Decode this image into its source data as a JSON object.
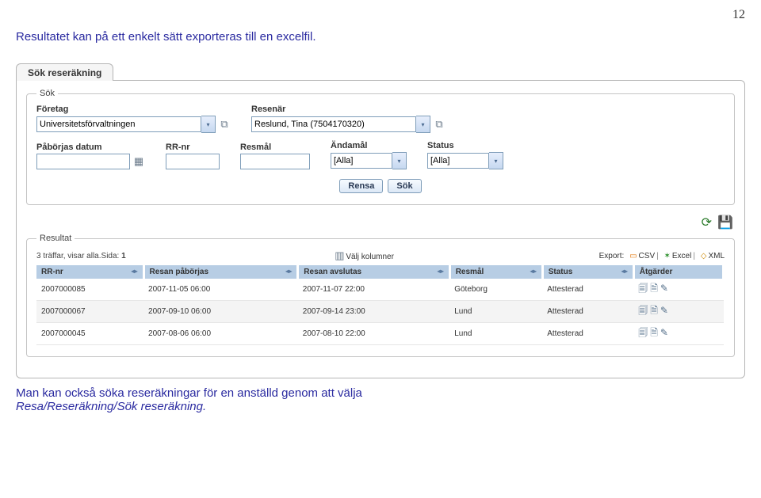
{
  "page_number": "12",
  "intro_text": "Resultatet kan på ett enkelt sätt exporteras till en excelfil.",
  "tab_label": "Sök reseräkning",
  "search": {
    "legend": "Sök",
    "company_label": "Företag",
    "company_value": "Universitetsförvaltningen",
    "traveller_label": "Resenär",
    "traveller_value": "Reslund, Tina (7504170320)",
    "start_date_label": "Påbörjas datum",
    "start_date_value": "",
    "rr_label": "RR-nr",
    "rr_value": "",
    "dest_label": "Resmål",
    "dest_value": "",
    "purpose_label": "Ändamål",
    "purpose_value": "[Alla]",
    "status_label": "Status",
    "status_value": "[Alla]",
    "clear_btn": "Rensa",
    "search_btn": "Sök"
  },
  "results": {
    "legend": "Resultat",
    "summary_prefix": "3 träffar, visar alla.Sida: ",
    "page_current": "1",
    "choose_cols": "Välj kolumner",
    "export_label": "Export:",
    "export_csv": "CSV",
    "export_xls": "Excel",
    "export_xml": "XML",
    "headers": {
      "rr": "RR-nr",
      "start": "Resan påbörjas",
      "end": "Resan avslutas",
      "dest": "Resmål",
      "status": "Status",
      "actions": "Åtgärder"
    },
    "rows": [
      {
        "rr": "2007000085",
        "start": "2007-11-05 06:00",
        "end": "2007-11-07 22:00",
        "dest": "Göteborg",
        "status": "Attesterad"
      },
      {
        "rr": "2007000067",
        "start": "2007-09-10 06:00",
        "end": "2007-09-14 23:00",
        "dest": "Lund",
        "status": "Attesterad"
      },
      {
        "rr": "2007000045",
        "start": "2007-08-06 06:00",
        "end": "2007-08-10 22:00",
        "dest": "Lund",
        "status": "Attesterad"
      }
    ]
  },
  "outro_text_1": "Man kan också söka reseräkningar för en anställd genom att välja",
  "outro_text_2": "Resa/Reseräkning/Sök reseräkning."
}
